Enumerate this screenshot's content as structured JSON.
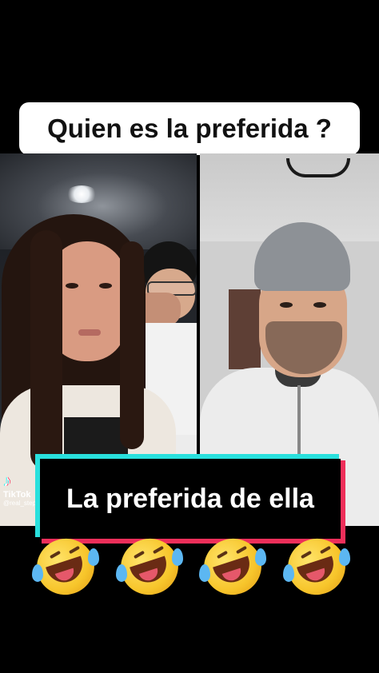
{
  "header": {
    "caption": "Quien es la preferida ?"
  },
  "overlay": {
    "caption": "La preferida de ella"
  },
  "watermark": {
    "brand": "TikTok",
    "username": "@real_stephany"
  },
  "reactions": [
    {
      "icon": "rolling-on-the-floor-laughing-emoji"
    },
    {
      "icon": "rolling-on-the-floor-laughing-emoji"
    },
    {
      "icon": "rolling-on-the-floor-laughing-emoji"
    },
    {
      "icon": "rolling-on-the-floor-laughing-emoji"
    }
  ],
  "colors": {
    "background": "#000000",
    "caption_box": "#ffffff",
    "accent_cyan": "#29e0dd",
    "accent_pink": "#ef2f5a"
  }
}
